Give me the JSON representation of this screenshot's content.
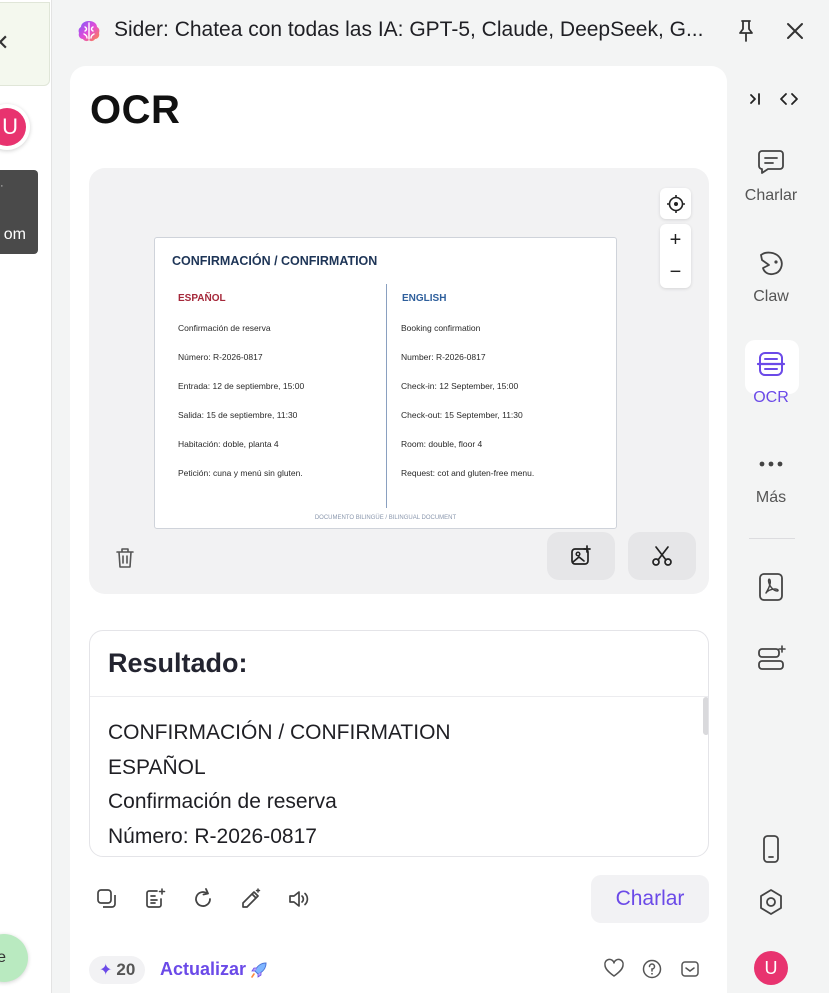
{
  "app": {
    "title": "Sider: Chatea con todas las IA: GPT-5, Claude, DeepSeek, G..."
  },
  "left_page": {
    "avatar_initial": "U",
    "tooltip_tail": "om",
    "tooltip_mark": "·",
    "green_btn_tail": "e"
  },
  "main": {
    "title": "OCR",
    "document": {
      "title": "CONFIRMACIÓN / CONFIRMATION",
      "left_heading": "ESPAÑOL",
      "right_heading": "ENGLISH",
      "left_lines": [
        "Confirmación de reserva",
        "Número: R-2026-0817",
        "Entrada: 12 de septiembre, 15:00",
        "Salida: 15 de septiembre, 11:30",
        "Habitación: doble, planta 4",
        "Petición: cuna y menú sin gluten."
      ],
      "right_lines": [
        "Booking confirmation",
        "Number: R-2026-0817",
        "Check-in: 12 September, 15:00",
        "Check-out: 15 September, 11:30",
        "Room: double, floor 4",
        "Request: cot and gluten-free menu."
      ],
      "footer": "DOCUMENTO BILINGÜE / BILINGUAL DOCUMENT"
    },
    "zoom_in": "+",
    "zoom_out": "−",
    "result": {
      "title": "Resultado:",
      "lines": [
        "CONFIRMACIÓN / CONFIRMATION",
        "ESPAÑOL",
        "Confirmación de reserva",
        "Número: R-2026-0817"
      ]
    },
    "charlar_button": "Charlar",
    "credits": "20",
    "upgrade_label": "Actualizar"
  },
  "rail": {
    "items": [
      {
        "label": "Charlar",
        "icon": "chat-icon"
      },
      {
        "label": "Claw",
        "icon": "claw-icon"
      },
      {
        "label": "OCR",
        "icon": "ocr-icon"
      },
      {
        "label": "Más",
        "icon": "more-icon"
      }
    ],
    "avatar_initial": "U"
  },
  "colors": {
    "accent": "#6b4ae8",
    "avatar": "#e8336f",
    "doc_heading_es": "#a5283a",
    "doc_heading_en": "#2e5f9c",
    "doc_title": "#1e3557"
  }
}
